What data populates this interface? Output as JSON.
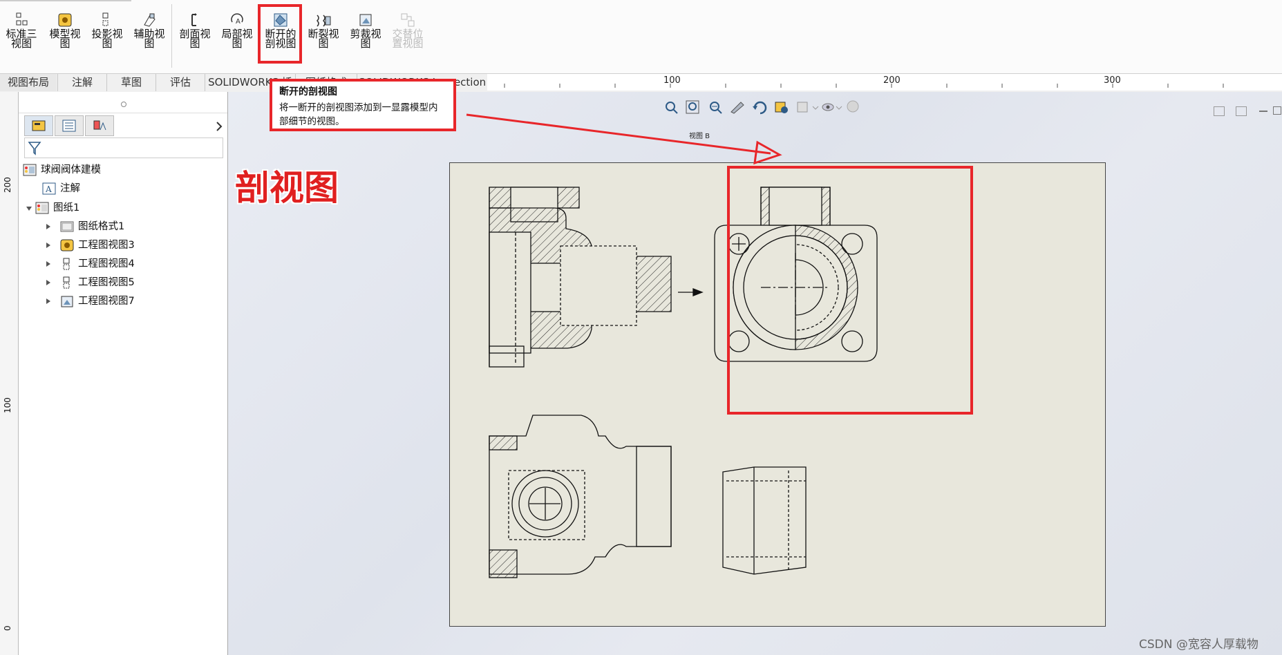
{
  "ribbon": {
    "buttons": [
      {
        "label": "标准三视图",
        "icon": "standard-three-view-icon"
      },
      {
        "label": "模型视图",
        "icon": "model-view-icon"
      },
      {
        "label": "投影视图",
        "icon": "projected-view-icon"
      },
      {
        "label": "辅助视图",
        "icon": "auxiliary-view-icon"
      },
      {
        "label": "剖面视图",
        "icon": "section-view-icon"
      },
      {
        "label": "局部视图",
        "icon": "detail-view-icon"
      },
      {
        "label": "断开的剖视图",
        "icon": "broken-out-section-icon",
        "highlighted": true
      },
      {
        "label": "断裂视图",
        "icon": "break-view-icon"
      },
      {
        "label": "剪裁视图",
        "icon": "crop-view-icon"
      },
      {
        "label": "交替位置视图",
        "icon": "alternate-position-view-icon",
        "disabled": true
      }
    ]
  },
  "tabs": [
    "视图布局",
    "注解",
    "草图",
    "评估",
    "SOLIDWORKS 插件",
    "图纸格式",
    "SOLIDWORKS Inspection"
  ],
  "active_tab": "视图布局",
  "ruler_top": [
    "100",
    "200",
    "300"
  ],
  "ruler_left": [
    "200",
    "100",
    "0"
  ],
  "tooltip": {
    "title": "断开的剖视图",
    "body": "将一断开的剖视图添加到一显露模型内部细节的视图。"
  },
  "tree": {
    "root": "球阀阀体建模",
    "items": [
      {
        "label": "注解",
        "level": 1
      },
      {
        "label": "图纸1",
        "level": 1
      },
      {
        "label": "图纸格式1",
        "level": 2
      },
      {
        "label": "工程图视图3",
        "level": 2
      },
      {
        "label": "工程图视图4",
        "level": 2
      },
      {
        "label": "工程图视图5",
        "level": 2
      },
      {
        "label": "工程图视图7",
        "level": 2
      }
    ]
  },
  "view_label": "视图 B",
  "callout": "剖视图",
  "watermark": "CSDN @宽容人厚载物",
  "colors": {
    "highlight": "#e8262a",
    "sheet": "#e8e7dc"
  }
}
